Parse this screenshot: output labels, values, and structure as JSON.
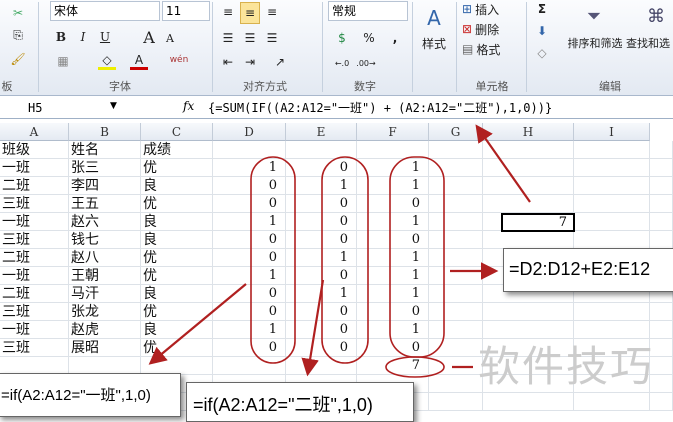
{
  "ribbon": {
    "font_name": "宋体",
    "font_size": "11",
    "number_format": "常规",
    "groups": {
      "clipboard": "板",
      "font": "字体",
      "alignment": "对齐方式",
      "number": "数字",
      "cells": "单元格",
      "editing": "编辑"
    },
    "buttons": {
      "bold": "B",
      "italic": "I",
      "underline": "U",
      "grow": "A",
      "shrink": "A",
      "percent": "%",
      "comma": ",",
      "styles": "样式",
      "insert": "插入",
      "delete": "删除",
      "format": "格式",
      "sigma": "Σ",
      "sort_filter": "排序和筛选",
      "find_select": "查找和选",
      "phonetic": "wén"
    }
  },
  "formula_bar": {
    "name_box": "H5",
    "fx": "fx",
    "formula": "{=SUM(IF((A2:A12=\"一班\") + (A2:A12=\"二班\"),1,0))}"
  },
  "columns": [
    "A",
    "B",
    "C",
    "D",
    "E",
    "F",
    "G",
    "H",
    "I"
  ],
  "rows": [
    [
      "班级",
      "姓名",
      "成绩",
      "",
      "",
      ""
    ],
    [
      "一班",
      "张三",
      "优",
      "1",
      "0",
      "1"
    ],
    [
      "二班",
      "李四",
      "良",
      "0",
      "1",
      "1"
    ],
    [
      "三班",
      "王五",
      "优",
      "0",
      "0",
      "0"
    ],
    [
      "一班",
      "赵六",
      "良",
      "1",
      "0",
      "1"
    ],
    [
      "三班",
      "钱七",
      "良",
      "0",
      "0",
      "0"
    ],
    [
      "二班",
      "赵八",
      "优",
      "0",
      "1",
      "1"
    ],
    [
      "一班",
      "王朝",
      "优",
      "1",
      "0",
      "1"
    ],
    [
      "二班",
      "马汗",
      "良",
      "0",
      "1",
      "1"
    ],
    [
      "三班",
      "张龙",
      "优",
      "0",
      "0",
      "0"
    ],
    [
      "一班",
      "赵虎",
      "良",
      "1",
      "0",
      "1"
    ],
    [
      "三班",
      "展昭",
      "优",
      "0",
      "0",
      "0"
    ]
  ],
  "f_total": "7",
  "h5_value": "7",
  "callouts": {
    "d": "=if(A2:A12=\"一班\",1,0)",
    "e": "=if(A2:A12=\"二班\",1,0)",
    "f": "=D2:D12+E2:E12"
  },
  "watermark": "软件技巧",
  "colors": {
    "annotation": "#b02020",
    "selection": "#000000"
  }
}
